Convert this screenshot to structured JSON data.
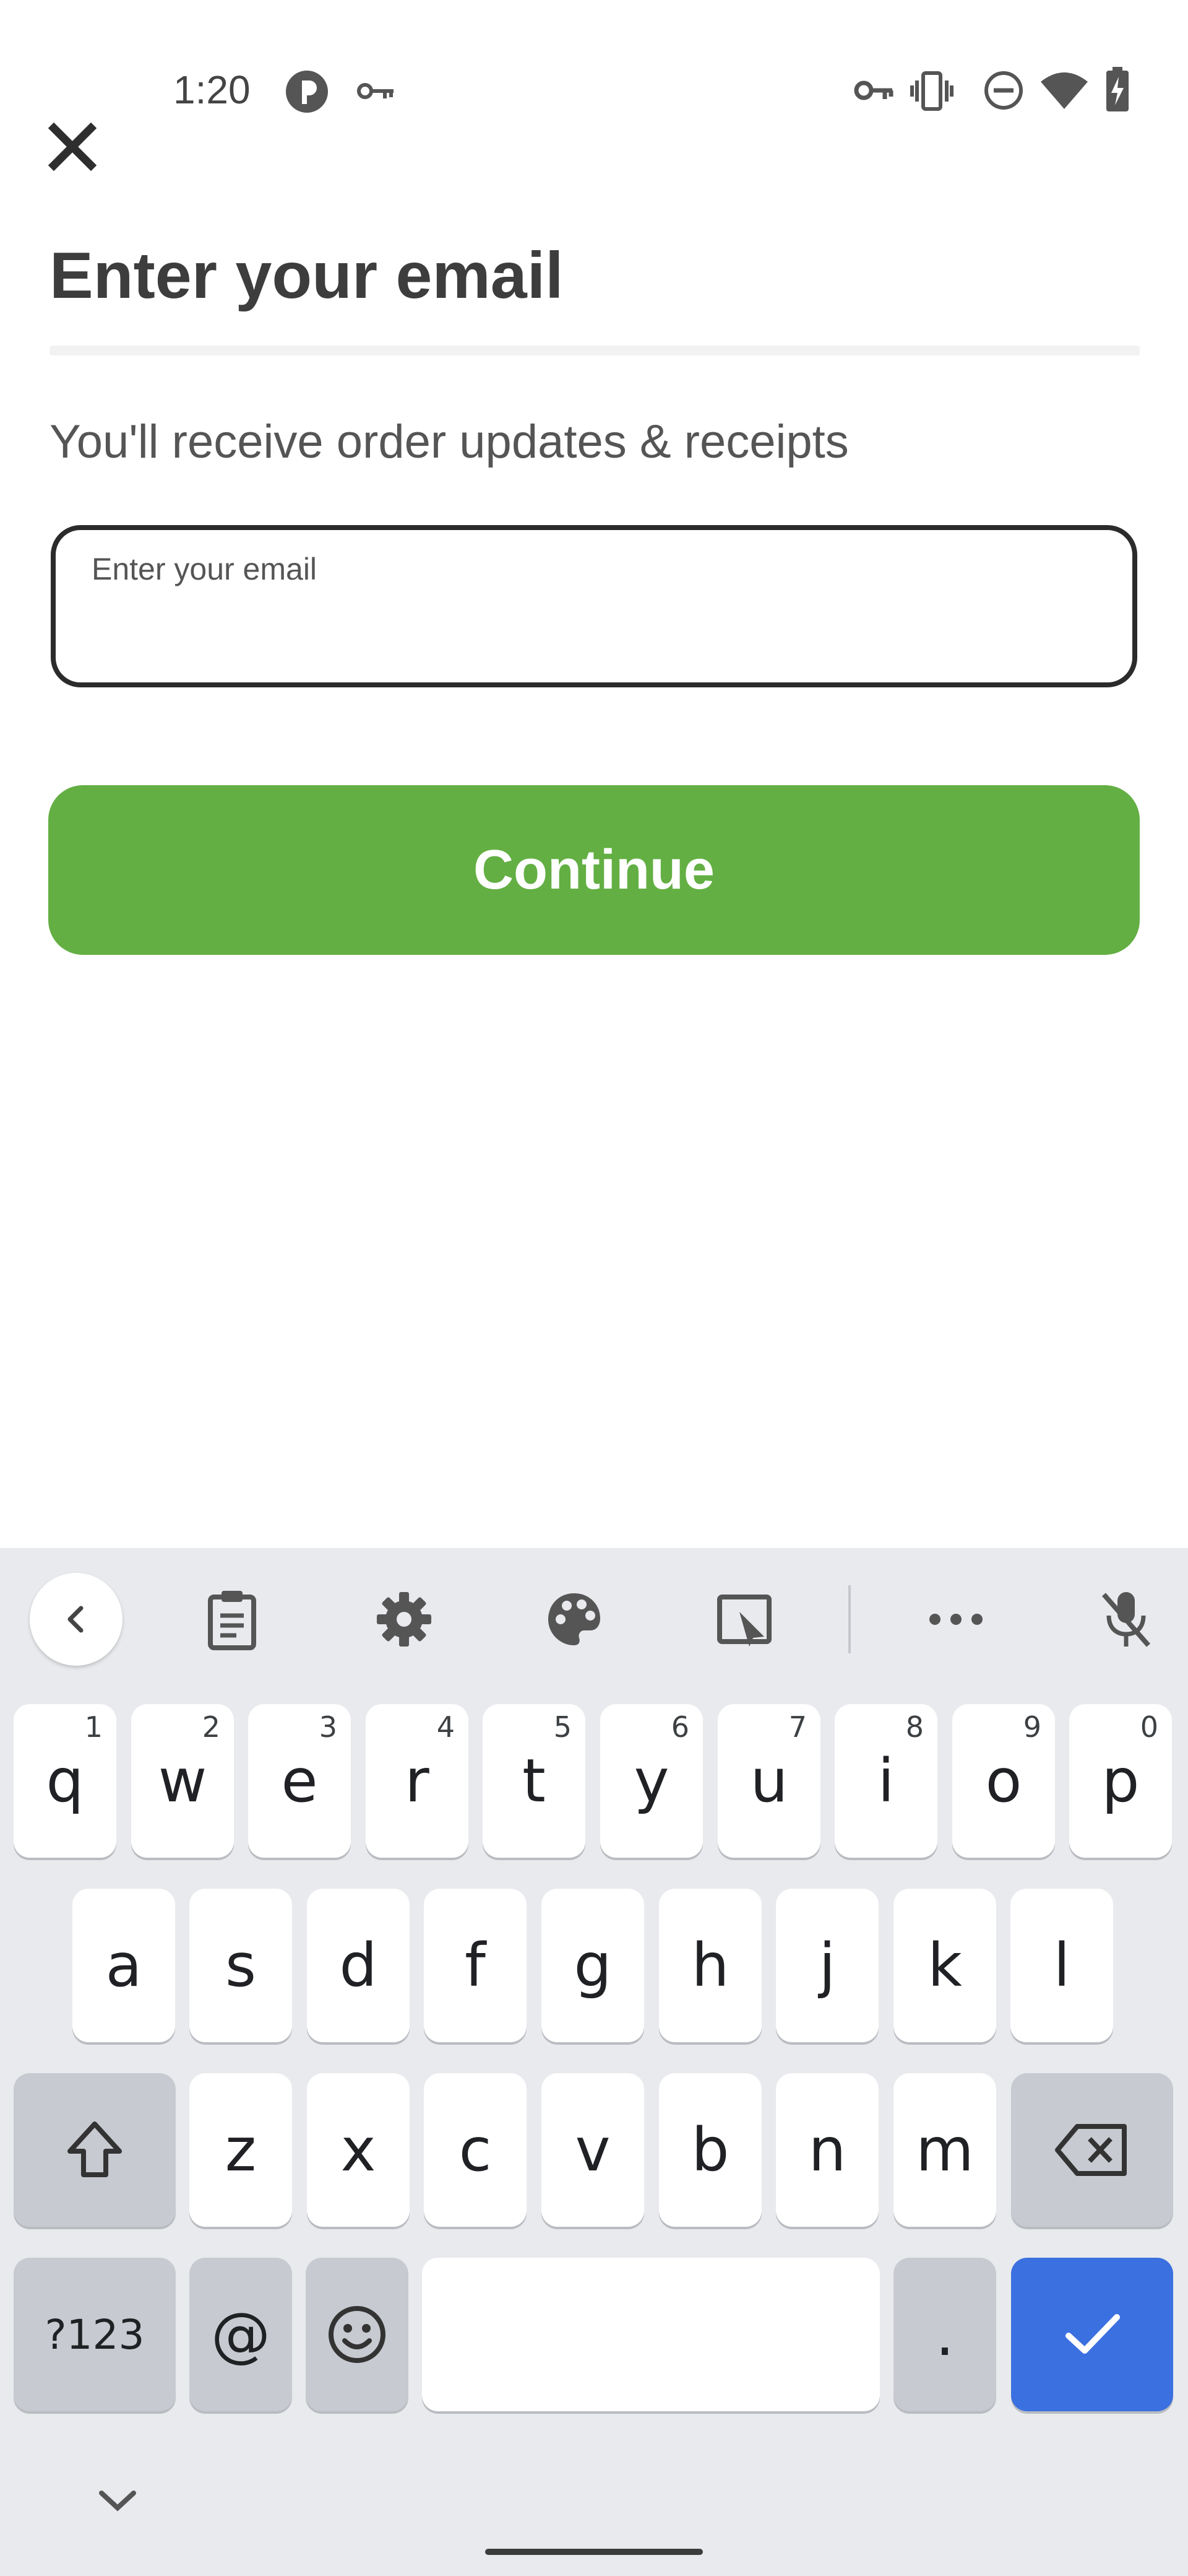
{
  "status_bar": {
    "time": "1:20",
    "left_icons": [
      "app-notification-icon",
      "key-icon"
    ],
    "right_icons": [
      "vpn-key-icon",
      "vibrate-icon",
      "do-not-disturb-icon",
      "wifi-icon",
      "battery-charging-icon"
    ]
  },
  "header": {
    "close_icon": "close-icon",
    "title": "Enter your email",
    "subtitle": "You'll receive order updates & receipts"
  },
  "email_field": {
    "label": "Enter your email",
    "value": ""
  },
  "continue_button": {
    "label": "Continue",
    "color": "#63af43"
  },
  "keyboard": {
    "toolbar_icons": [
      "back-icon",
      "clipboard-icon",
      "settings-icon",
      "theme-palette-icon",
      "floating-keyboard-icon",
      "more-icon",
      "mic-off-icon"
    ],
    "row1": [
      {
        "char": "q",
        "hint": "1"
      },
      {
        "char": "w",
        "hint": "2"
      },
      {
        "char": "e",
        "hint": "3"
      },
      {
        "char": "r",
        "hint": "4"
      },
      {
        "char": "t",
        "hint": "5"
      },
      {
        "char": "y",
        "hint": "6"
      },
      {
        "char": "u",
        "hint": "7"
      },
      {
        "char": "i",
        "hint": "8"
      },
      {
        "char": "o",
        "hint": "9"
      },
      {
        "char": "p",
        "hint": "0"
      }
    ],
    "row2": [
      "a",
      "s",
      "d",
      "f",
      "g",
      "h",
      "j",
      "k",
      "l"
    ],
    "row3": [
      "z",
      "x",
      "c",
      "v",
      "b",
      "n",
      "m"
    ],
    "symbols_label": "?123",
    "at_label": "@",
    "period_label": ".",
    "accent_color": "#3b70e0"
  }
}
